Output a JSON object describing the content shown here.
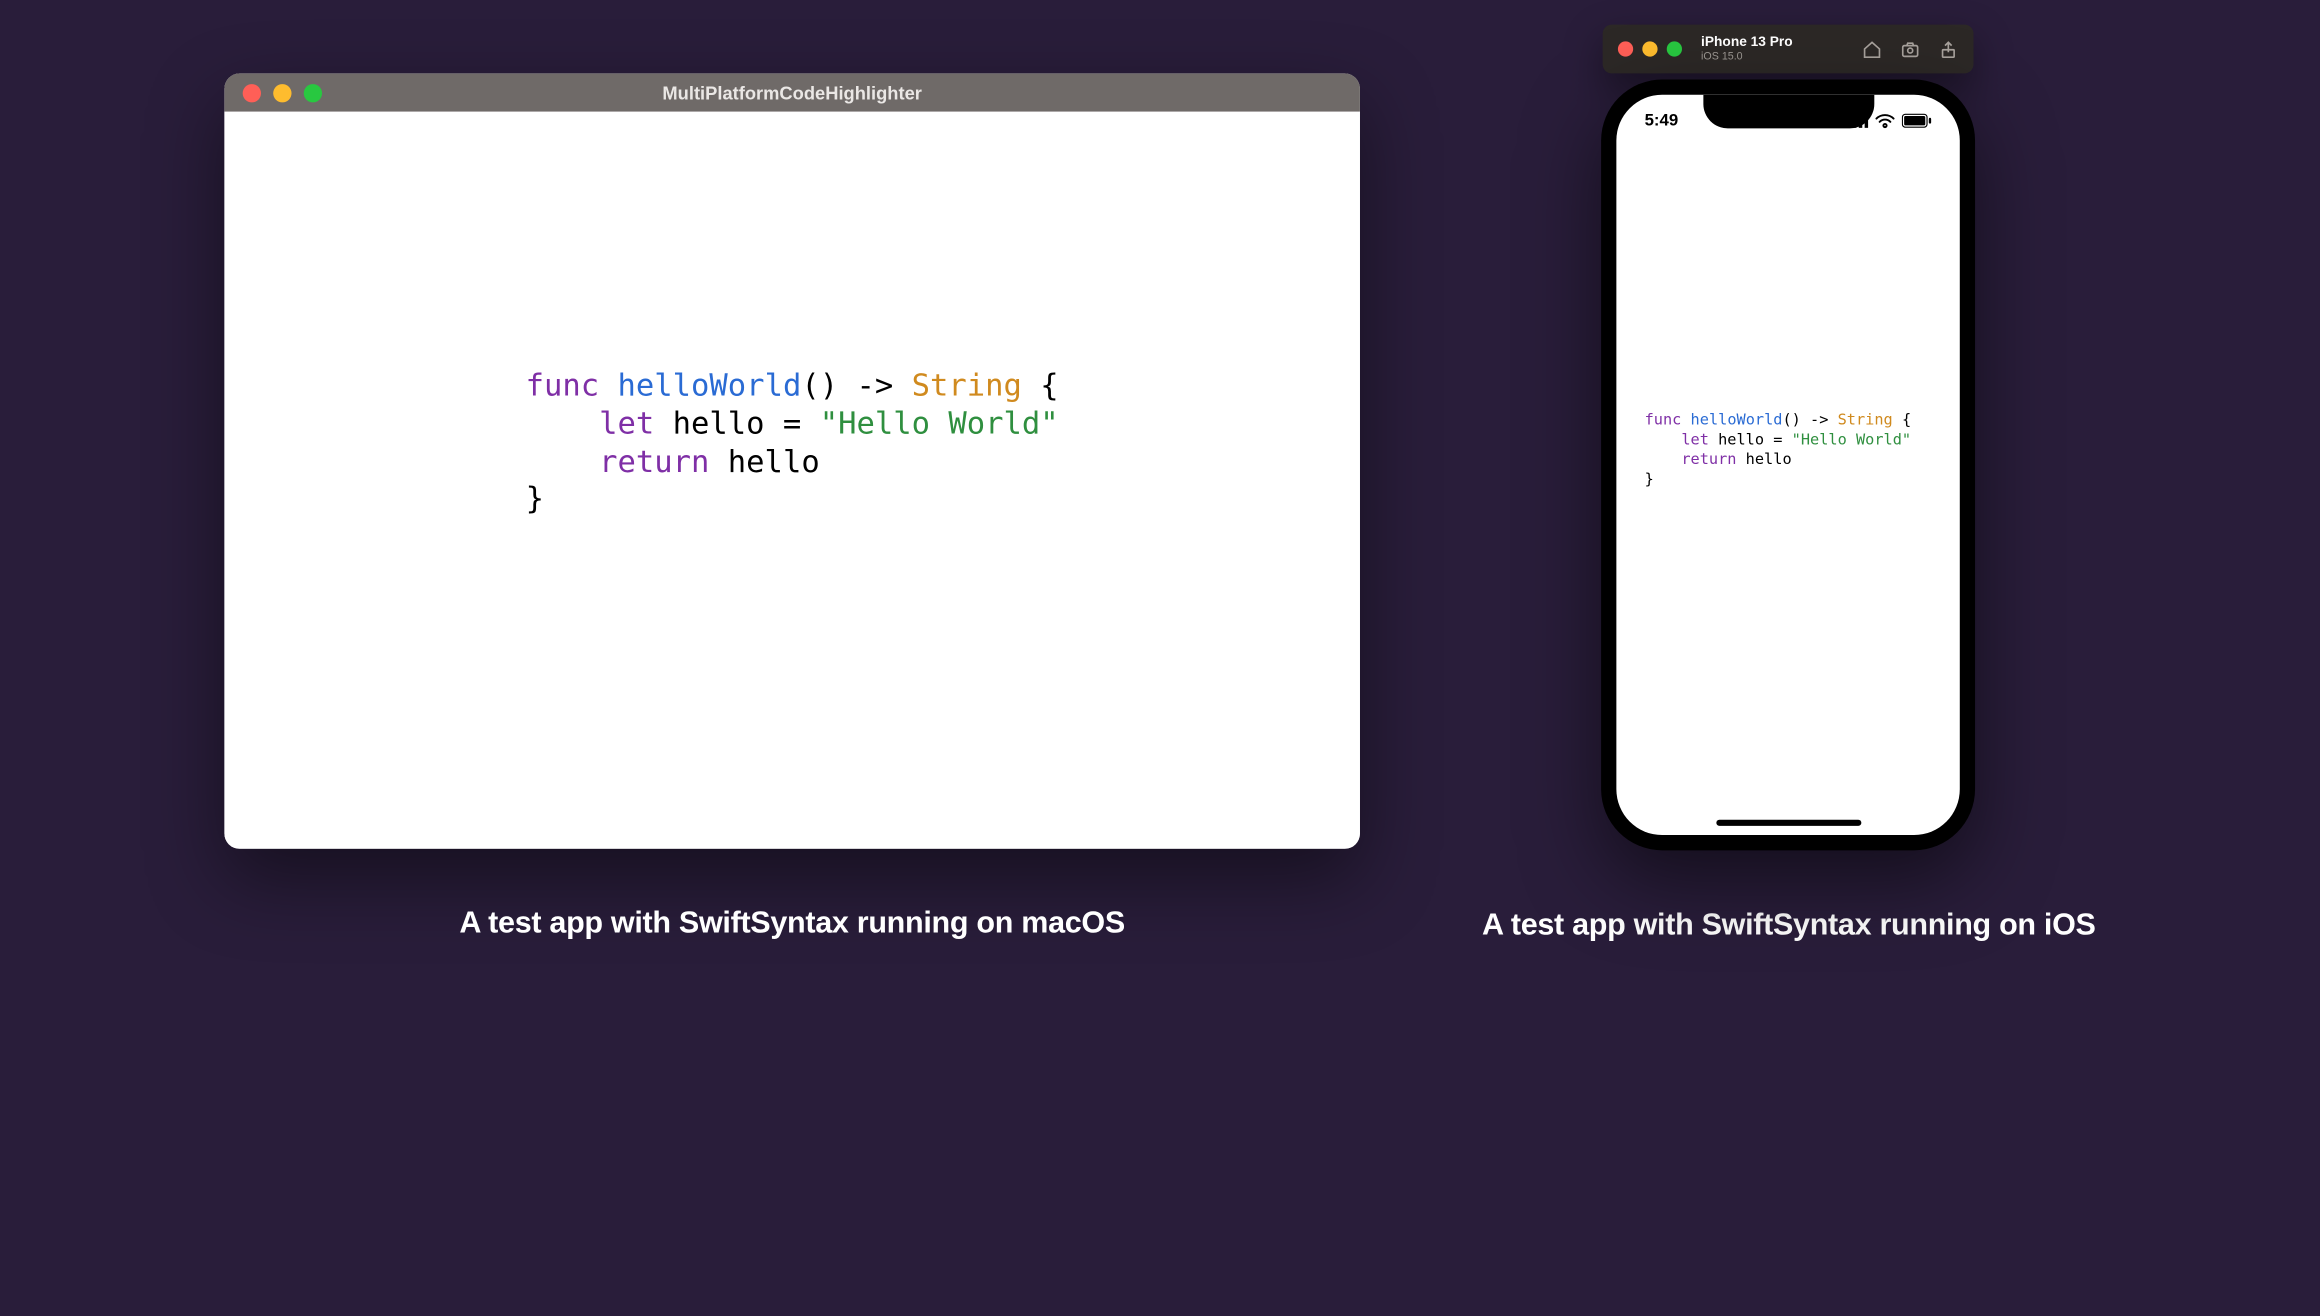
{
  "mac": {
    "title": "MultiPlatformCodeHighlighter",
    "caption": "A test app with SwiftSyntax running on macOS",
    "code": {
      "kw_func": "func",
      "fn_name": "helloWorld",
      "sig_tail": "() -> ",
      "ret_type": "String",
      "brace_open": " {",
      "kw_let": "let",
      "var_name": " hello = ",
      "string": "\"Hello World\"",
      "kw_return": "return",
      "ret_expr": " hello",
      "brace_close": "}"
    }
  },
  "sim": {
    "device": "iPhone 13 Pro",
    "os": "iOS 15.0",
    "caption": "A test app with SwiftSyntax running on iOS"
  },
  "phone": {
    "time": "5:49",
    "code": {
      "kw_func": "func",
      "fn_name": "helloWorld",
      "sig_tail": "() -> ",
      "ret_type": "String",
      "brace_open": " {",
      "kw_let": "let",
      "var_name": " hello = ",
      "string": "\"Hello World\"",
      "kw_return": "return",
      "ret_expr": " hello",
      "brace_close": "}"
    }
  },
  "colors": {
    "bg": "#291d3a",
    "titlebar": "#6f6a68",
    "sim_header": "#2c2826"
  }
}
